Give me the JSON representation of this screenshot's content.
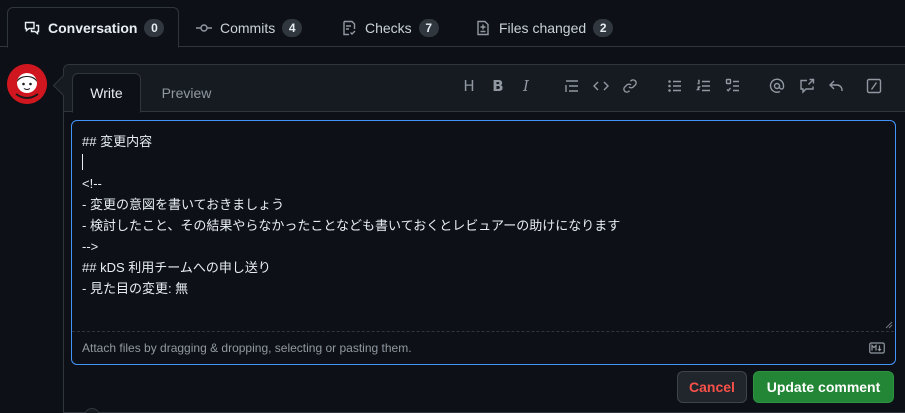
{
  "pr_tabs": [
    {
      "label": "Conversation",
      "count": "0",
      "icon": "comment-discussion-icon",
      "active": true
    },
    {
      "label": "Commits",
      "count": "4",
      "icon": "git-commit-icon",
      "active": false
    },
    {
      "label": "Checks",
      "count": "7",
      "icon": "checklist-icon",
      "active": false
    },
    {
      "label": "Files changed",
      "count": "2",
      "icon": "file-diff-icon",
      "active": false
    }
  ],
  "editor": {
    "tabs": {
      "write": "Write",
      "preview": "Preview"
    },
    "toolbar": [
      "heading-icon",
      "bold-icon",
      "italic-icon",
      "quote-icon",
      "code-icon",
      "link-icon",
      "unordered-list-icon",
      "ordered-list-icon",
      "task-list-icon",
      "mention-icon",
      "cross-reference-icon",
      "reply-icon",
      "slash-commands-icon"
    ],
    "lines": [
      "## 変更内容",
      "",
      "<!--",
      "- 変更の意図を書いておきましょう",
      "- 検討したこと、その結果やらなかったことなども書いておくとレビュアーの助けになります",
      "-->",
      "",
      "## kDS 利用チームへの申し送り",
      "",
      "- 見た目の変更: 無"
    ],
    "attach_text": "Attach files by dragging & dropping, selecting or pasting them.",
    "markdown_icon": "markdown-icon"
  },
  "actions": {
    "cancel": "Cancel",
    "update": "Update comment"
  },
  "colors": {
    "background": "#0d1117",
    "focus_border": "#4493f8",
    "cancel_text": "#f85149",
    "update_bg": "#238636"
  }
}
